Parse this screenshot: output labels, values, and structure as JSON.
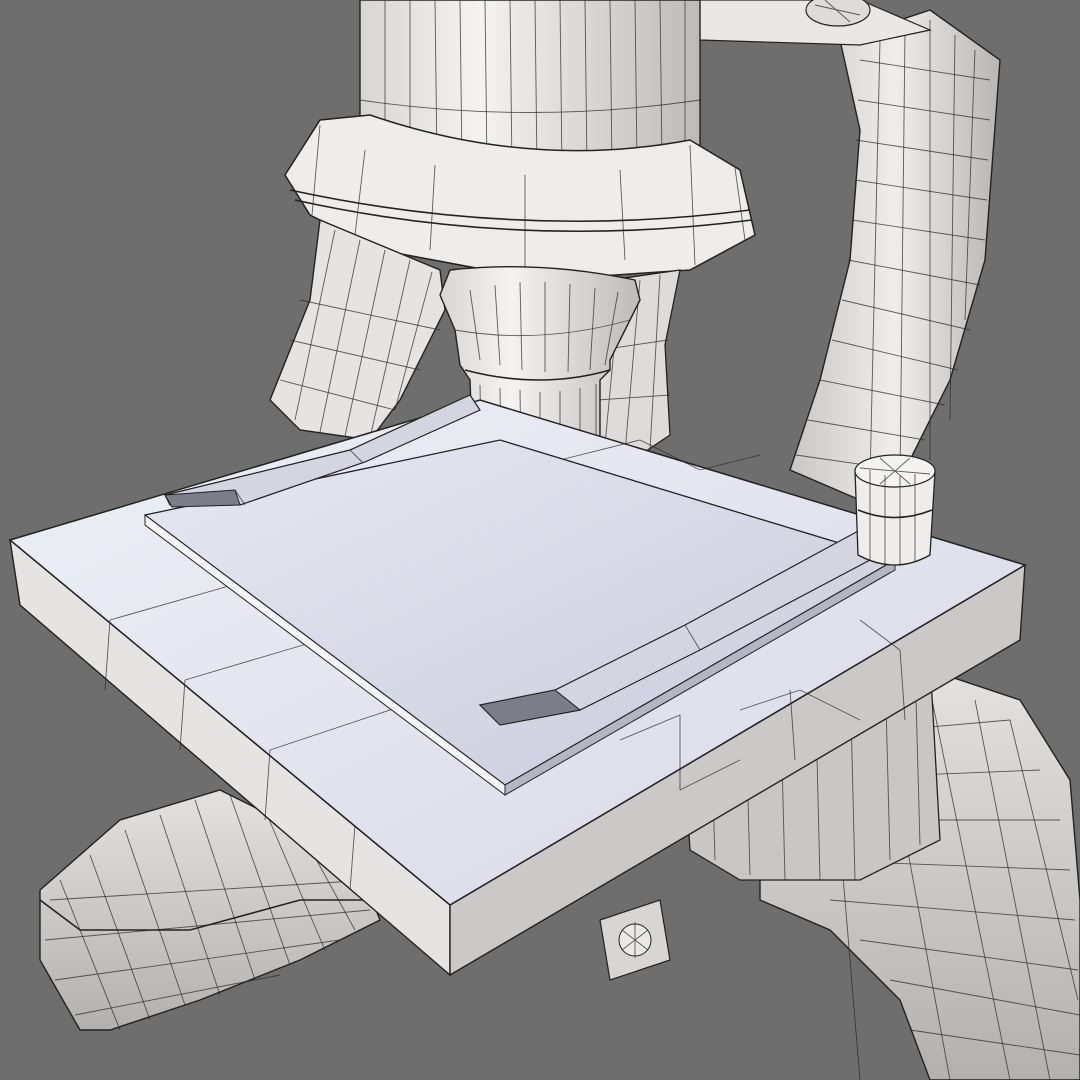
{
  "scene": {
    "subject": "microscope-wireframe-render",
    "colors": {
      "background": "#6e6e6e",
      "body_light": "#f0efee",
      "body_mid": "#dcdad8",
      "body_shadow": "#a9a7a6",
      "stage_top": "#e8e9f1",
      "stage_slide": "#d9dae6",
      "wire": "#2a2a2a",
      "clip": "#cfd0dc",
      "clip_tip": "#7c7d88"
    },
    "parts": [
      "eyepiece-tube",
      "revolving-nosepiece",
      "objective-lens-left",
      "objective-lens-center",
      "objective-lens-right",
      "arm",
      "stage",
      "specimen-slide",
      "stage-clip-left",
      "stage-clip-right",
      "clip-post",
      "focus-knob",
      "base-foot-left",
      "base-foot-right"
    ]
  }
}
